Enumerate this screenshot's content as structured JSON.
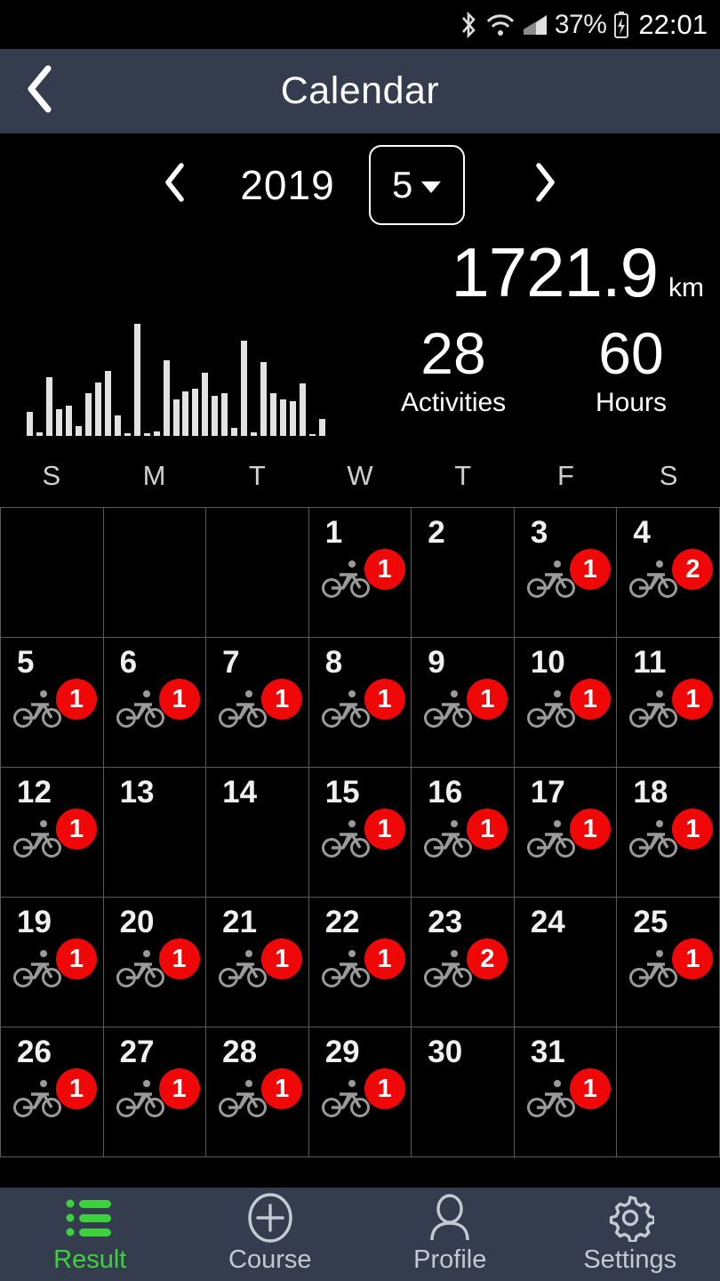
{
  "status_bar": {
    "battery_percent": "37%",
    "time": "22:01",
    "icons": [
      "bluetooth-icon",
      "wifi-icon",
      "cellular-signal-icon",
      "battery-charging-icon"
    ]
  },
  "header": {
    "title": "Calendar",
    "back_icon": "chevron-left-icon"
  },
  "month_nav": {
    "prev_icon": "chevron-left-icon",
    "next_icon": "chevron-right-icon",
    "year": "2019",
    "month": "5",
    "dropdown_icon": "caret-down-icon"
  },
  "summary": {
    "distance_value": "1721.9",
    "distance_unit": "km",
    "activities_value": "28",
    "activities_label": "Activities",
    "hours_value": "60",
    "hours_label": "Hours"
  },
  "weekdays": [
    "S",
    "M",
    "T",
    "W",
    "T",
    "F",
    "S"
  ],
  "calendar": {
    "cells": [
      {
        "day": "",
        "count": ""
      },
      {
        "day": "",
        "count": ""
      },
      {
        "day": "",
        "count": ""
      },
      {
        "day": "1",
        "count": "1"
      },
      {
        "day": "2",
        "count": ""
      },
      {
        "day": "3",
        "count": "1"
      },
      {
        "day": "4",
        "count": "2"
      },
      {
        "day": "5",
        "count": "1"
      },
      {
        "day": "6",
        "count": "1"
      },
      {
        "day": "7",
        "count": "1"
      },
      {
        "day": "8",
        "count": "1"
      },
      {
        "day": "9",
        "count": "1"
      },
      {
        "day": "10",
        "count": "1"
      },
      {
        "day": "11",
        "count": "1"
      },
      {
        "day": "12",
        "count": "1"
      },
      {
        "day": "13",
        "count": ""
      },
      {
        "day": "14",
        "count": ""
      },
      {
        "day": "15",
        "count": "1"
      },
      {
        "day": "16",
        "count": "1"
      },
      {
        "day": "17",
        "count": "1"
      },
      {
        "day": "18",
        "count": "1"
      },
      {
        "day": "19",
        "count": "1"
      },
      {
        "day": "20",
        "count": "1"
      },
      {
        "day": "21",
        "count": "1"
      },
      {
        "day": "22",
        "count": "1"
      },
      {
        "day": "23",
        "count": "2"
      },
      {
        "day": "24",
        "count": ""
      },
      {
        "day": "25",
        "count": "1"
      },
      {
        "day": "26",
        "count": "1"
      },
      {
        "day": "27",
        "count": "1"
      },
      {
        "day": "28",
        "count": "1"
      },
      {
        "day": "29",
        "count": "1"
      },
      {
        "day": "30",
        "count": ""
      },
      {
        "day": "31",
        "count": "1"
      },
      {
        "day": "",
        "count": ""
      }
    ],
    "activity_icon": "bicycle-icon"
  },
  "bottom_nav": {
    "items": [
      {
        "label": "Result",
        "icon": "list-icon",
        "active": true
      },
      {
        "label": "Course",
        "icon": "plus-circle-icon",
        "active": false
      },
      {
        "label": "Profile",
        "icon": "person-icon",
        "active": false
      },
      {
        "label": "Settings",
        "icon": "gear-icon",
        "active": false
      }
    ],
    "active_color": "#3dd13d",
    "inactive_color": "#c4c9d2",
    "background_color": "#343c4e"
  },
  "colors": {
    "background": "#000000",
    "header_bar": "#343c4e",
    "badge_red": "#f00808",
    "bar_fill": "#e2e2e2",
    "grid_line": "#5a5a5a"
  },
  "chart_data": {
    "type": "bar",
    "title": "",
    "xlabel": "",
    "ylabel": "",
    "categories": [
      "1",
      "2",
      "3",
      "4",
      "5",
      "6",
      "7",
      "8",
      "9",
      "10",
      "11",
      "12",
      "13",
      "14",
      "15",
      "16",
      "17",
      "18",
      "19",
      "20",
      "21",
      "22",
      "23",
      "24",
      "25",
      "26",
      "27",
      "28",
      "29",
      "30",
      "31"
    ],
    "values": [
      25,
      4,
      62,
      28,
      32,
      10,
      45,
      56,
      68,
      22,
      3,
      118,
      3,
      5,
      80,
      38,
      47,
      50,
      67,
      42,
      45,
      8,
      100,
      4,
      78,
      45,
      38,
      37,
      55,
      2,
      18
    ],
    "ylim": [
      0,
      120
    ],
    "grid": false,
    "legend": "none"
  }
}
